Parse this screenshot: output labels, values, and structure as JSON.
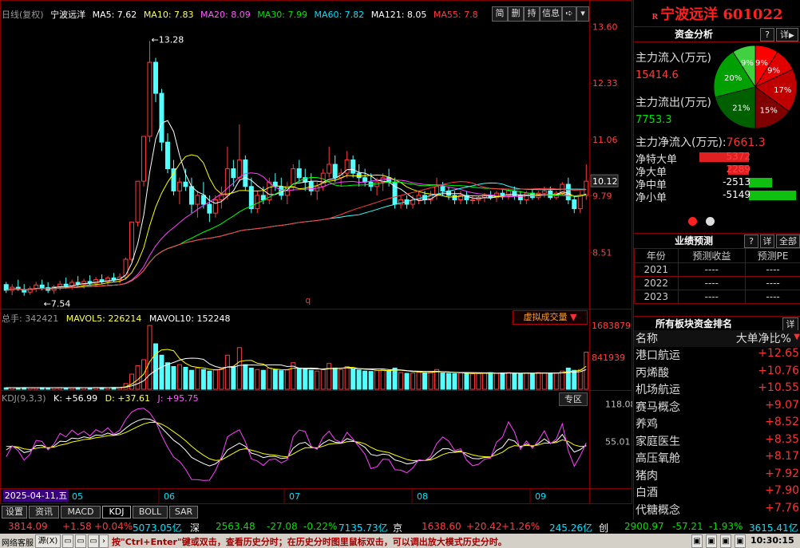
{
  "header": {
    "chart_name": "日线(复权)",
    "stock_name": "宁波远洋",
    "ma5": "MA5: 7.62",
    "ma10": "MA10: 7.83",
    "ma20": "MA20: 8.09",
    "ma30": "MA30: 7.99",
    "ma60": "MA60: 7.82",
    "ma121": "MA121: 8.05",
    "ma55": "MA55: 7.8",
    "tools": [
      "简",
      "删",
      "持",
      "信息"
    ]
  },
  "colors": {
    "ma5": "#ffffff",
    "ma10": "#ffff00",
    "ma20": "#ff40ff",
    "ma30": "#00ff00",
    "ma60": "#40ffff",
    "ma121": "#ffffff",
    "ma55": "#ff4040",
    "up": "#ff3c3c",
    "down": "#54ffff"
  },
  "price_axis": [
    "13.60",
    "12.33",
    "11.06",
    "10.12",
    "9.79",
    "8.51"
  ],
  "annotations": {
    "high": "13.28",
    "low": "7.54",
    "q_marker": "q"
  },
  "volume_header": {
    "total": "总手: 342421",
    "mavol5": "MAVOL5: 226214",
    "mavol10": "MAVOL10: 152248",
    "virtual_btn": "虚拟成交量"
  },
  "volume_axis": [
    "1683879",
    "841939"
  ],
  "kdj_header": {
    "name": "KDJ(9,3,3)",
    "k": "K: +56.99",
    "d": "D: +37.61",
    "j": "J: +95.75",
    "zq_btn": "专区"
  },
  "kdj_axis": [
    "118.08",
    "55.01"
  ],
  "date_axis": {
    "current": "2025-04-11,五",
    "months": [
      "05",
      "06",
      "07",
      "08",
      "09"
    ]
  },
  "tabs": [
    "设置",
    "资讯",
    "MACD",
    "KDJ",
    "BOLL",
    "SAR"
  ],
  "right_panel": {
    "title": "宁波远洋 601022",
    "flow_section": {
      "title": "资金分析",
      "btn_q": "?",
      "btn_detail": "详"
    },
    "inflow_label": "主力流入(万元)",
    "inflow_value": "15414.6",
    "outflow_label": "主力流出(万元)",
    "outflow_value": "7753.3",
    "net_label": "主力净流入(万元):",
    "net_value": "7661.3",
    "pie": [
      {
        "label": "9%",
        "value": 9,
        "color": "#ff0000"
      },
      {
        "label": "9%",
        "value": 9,
        "color": "#e00000"
      },
      {
        "label": "17%",
        "value": 17,
        "color": "#c00000"
      },
      {
        "label": "15%",
        "value": 15,
        "color": "#800000"
      },
      {
        "label": "21%",
        "value": 21,
        "color": "#006000"
      },
      {
        "label": "20%",
        "value": 20,
        "color": "#00a000"
      },
      {
        "label": "9%",
        "value": 9,
        "color": "#40d040"
      }
    ],
    "order_rows": [
      {
        "label": "净特大单",
        "value": "5372",
        "sign": "pos"
      },
      {
        "label": "净大单",
        "value": "2289",
        "sign": "pos"
      },
      {
        "label": "净中单",
        "value": "-2513",
        "sign": "neg"
      },
      {
        "label": "净小单",
        "value": "-5149",
        "sign": "neg"
      }
    ],
    "forecast": {
      "title": "业绩预测",
      "btn_q": "?",
      "btn_detail": "详",
      "btn_all": "全部",
      "headers": [
        "年份",
        "预测收益",
        "预测PE"
      ],
      "rows": [
        [
          "2021",
          "----",
          "----"
        ],
        [
          "2022",
          "----",
          "----"
        ],
        [
          "2023",
          "----",
          "----"
        ]
      ]
    },
    "sectors": {
      "title": "所有板块资金排名",
      "btn_detail": "详",
      "col_name": "名称",
      "col_val": "大单净比%",
      "rows": [
        {
          "name": "港口航运",
          "value": "+12.65"
        },
        {
          "name": "丙烯酸",
          "value": "+10.76"
        },
        {
          "name": "机场航运",
          "value": "+10.55"
        },
        {
          "name": "赛马概念",
          "value": "+9.07"
        },
        {
          "name": "养鸡",
          "value": "+8.52"
        },
        {
          "name": "家庭医生",
          "value": "+8.35"
        },
        {
          "name": "高压氧舱",
          "value": "+8.17"
        },
        {
          "name": "猪肉",
          "value": "+7.92"
        },
        {
          "name": "白酒",
          "value": "+7.90"
        },
        {
          "name": "代糖概念",
          "value": "+7.76"
        }
      ]
    }
  },
  "status_bar": {
    "idx1": "3814.09",
    "chg1": "+1.58",
    "pct1": "+0.04%",
    "amt1": "5073.05亿",
    "tag1": "深",
    "idx2": "2563.48",
    "chg2": "-27.08",
    "pct2": "-0.22%",
    "amt2": "7135.73亿",
    "tag2": "京",
    "idx3": "1638.60",
    "chg3": "+20.42",
    "pct3": "+1.26%",
    "amt3": "245.26亿",
    "tag3": "创",
    "idx4": "2900.97",
    "chg4": "-57.21",
    "pct4": "-1.93%",
    "amt4": "3615.41亿"
  },
  "bottom_bar": {
    "left": "网络客服",
    "btn": "源(X)",
    "hint": "按\"Ctrl+Enter\"键或双击，查看历史分时；在历史分时图里鼠标双击，可以调出放大模式历史分时。",
    "time": "10:30:15"
  },
  "chart_data": {
    "type": "candlestick",
    "title": "日线(复权)",
    "ylim": [
      7.3,
      13.7
    ],
    "ohlc": [
      [
        7.79,
        7.85,
        7.6,
        7.66
      ],
      [
        7.66,
        7.8,
        7.55,
        7.73
      ],
      [
        7.73,
        7.9,
        7.65,
        7.68
      ],
      [
        7.68,
        7.8,
        7.54,
        7.62
      ],
      [
        7.62,
        7.75,
        7.56,
        7.7
      ],
      [
        7.7,
        7.85,
        7.62,
        7.78
      ],
      [
        7.78,
        7.9,
        7.66,
        7.72
      ],
      [
        7.72,
        7.84,
        7.6,
        7.66
      ],
      [
        7.66,
        7.78,
        7.58,
        7.74
      ],
      [
        7.74,
        7.88,
        7.66,
        7.8
      ],
      [
        7.8,
        7.95,
        7.7,
        7.76
      ],
      [
        7.76,
        7.9,
        7.68,
        7.84
      ],
      [
        7.84,
        7.98,
        7.76,
        7.8
      ],
      [
        7.8,
        7.92,
        7.7,
        7.86
      ],
      [
        7.86,
        8.0,
        7.78,
        7.82
      ],
      [
        7.82,
        7.96,
        7.74,
        7.9
      ],
      [
        7.9,
        8.02,
        7.8,
        7.86
      ],
      [
        7.86,
        7.98,
        7.78,
        7.94
      ],
      [
        7.94,
        8.05,
        7.84,
        7.9
      ],
      [
        7.9,
        8.04,
        7.82,
        7.96
      ],
      [
        7.96,
        8.4,
        7.9,
        8.36
      ],
      [
        8.36,
        9.2,
        8.3,
        9.2
      ],
      [
        9.2,
        10.12,
        9.1,
        10.12
      ],
      [
        10.12,
        11.13,
        10.0,
        11.13
      ],
      [
        11.13,
        13.28,
        11.0,
        12.8
      ],
      [
        12.8,
        12.9,
        11.9,
        12.1
      ],
      [
        12.1,
        12.2,
        10.8,
        11.0
      ],
      [
        11.0,
        11.2,
        10.3,
        10.4
      ],
      [
        10.4,
        10.6,
        9.8,
        9.9
      ],
      [
        9.9,
        10.2,
        9.6,
        10.1
      ],
      [
        10.1,
        10.4,
        9.9,
        10.0
      ],
      [
        10.0,
        10.2,
        9.4,
        9.6
      ],
      [
        9.6,
        9.9,
        9.3,
        9.8
      ],
      [
        9.8,
        10.1,
        9.5,
        9.6
      ],
      [
        9.6,
        9.8,
        9.2,
        9.4
      ],
      [
        9.4,
        9.8,
        9.3,
        9.7
      ],
      [
        9.7,
        10.0,
        9.5,
        9.8
      ],
      [
        9.8,
        10.9,
        9.7,
        10.4
      ],
      [
        10.4,
        10.6,
        10.0,
        10.2
      ],
      [
        10.2,
        11.4,
        10.1,
        10.6
      ],
      [
        10.6,
        10.7,
        9.9,
        10.0
      ],
      [
        10.0,
        10.2,
        9.4,
        9.5
      ],
      [
        9.5,
        9.9,
        9.4,
        9.8
      ],
      [
        9.8,
        10.0,
        9.6,
        9.7
      ],
      [
        9.7,
        10.2,
        9.6,
        10.1
      ],
      [
        10.1,
        10.3,
        9.9,
        10.0
      ],
      [
        10.0,
        10.2,
        9.7,
        9.8
      ],
      [
        9.8,
        10.1,
        9.6,
        10.0
      ],
      [
        10.0,
        10.5,
        9.9,
        10.4
      ],
      [
        10.4,
        10.6,
        10.1,
        10.2
      ],
      [
        10.2,
        10.4,
        9.9,
        10.1
      ],
      [
        10.1,
        10.3,
        9.8,
        9.9
      ],
      [
        9.9,
        10.1,
        9.7,
        10.0
      ],
      [
        10.0,
        10.4,
        9.9,
        10.3
      ],
      [
        10.3,
        10.9,
        10.2,
        10.5
      ],
      [
        10.5,
        10.7,
        10.1,
        10.2
      ],
      [
        10.2,
        10.4,
        10.0,
        10.3
      ],
      [
        10.3,
        10.8,
        10.2,
        10.6
      ],
      [
        10.6,
        10.7,
        10.2,
        10.3
      ],
      [
        10.3,
        10.5,
        10.0,
        10.2
      ],
      [
        10.2,
        10.4,
        10.0,
        10.1
      ],
      [
        10.1,
        10.3,
        9.9,
        10.0
      ],
      [
        10.0,
        10.2,
        9.8,
        10.1
      ],
      [
        10.1,
        10.3,
        9.9,
        10.2
      ],
      [
        10.2,
        10.4,
        10.0,
        10.1
      ],
      [
        10.1,
        10.2,
        9.5,
        9.6
      ],
      [
        9.6,
        9.8,
        9.5,
        9.7
      ],
      [
        9.7,
        9.8,
        9.5,
        9.6
      ],
      [
        9.6,
        9.8,
        9.5,
        9.7
      ],
      [
        9.7,
        9.9,
        9.6,
        9.8
      ],
      [
        9.8,
        9.9,
        9.6,
        9.7
      ],
      [
        9.7,
        9.9,
        9.6,
        9.8
      ],
      [
        9.8,
        10.2,
        9.7,
        10.0
      ],
      [
        10.0,
        10.1,
        9.8,
        9.9
      ],
      [
        9.9,
        10.0,
        9.7,
        9.8
      ],
      [
        9.8,
        9.9,
        9.6,
        9.7
      ],
      [
        9.7,
        9.9,
        9.6,
        9.8
      ],
      [
        9.8,
        9.9,
        9.6,
        9.7
      ],
      [
        9.7,
        9.8,
        9.6,
        9.7
      ],
      [
        9.7,
        9.8,
        9.6,
        9.75
      ],
      [
        9.75,
        9.85,
        9.65,
        9.8
      ],
      [
        9.8,
        9.9,
        9.7,
        9.75
      ],
      [
        9.75,
        9.9,
        9.65,
        9.85
      ],
      [
        9.85,
        9.95,
        9.7,
        9.8
      ],
      [
        9.8,
        9.95,
        9.7,
        9.9
      ],
      [
        9.9,
        10.0,
        9.7,
        9.8
      ],
      [
        9.8,
        9.9,
        9.6,
        9.7
      ],
      [
        9.7,
        9.9,
        9.6,
        9.85
      ],
      [
        9.85,
        9.95,
        9.7,
        9.75
      ],
      [
        9.75,
        9.9,
        9.7,
        9.85
      ],
      [
        9.85,
        10.0,
        9.75,
        9.9
      ],
      [
        9.9,
        10.0,
        9.7,
        9.75
      ],
      [
        9.75,
        9.9,
        9.7,
        9.85
      ],
      [
        9.85,
        10.1,
        9.8,
        10.05
      ],
      [
        10.05,
        10.2,
        9.6,
        9.7
      ],
      [
        9.7,
        9.8,
        9.4,
        9.5
      ],
      [
        9.5,
        9.9,
        9.4,
        9.8
      ],
      [
        9.8,
        10.5,
        9.7,
        10.12
      ]
    ],
    "volume": [
      40,
      42,
      38,
      45,
      41,
      39,
      44,
      40,
      43,
      46,
      42,
      40,
      45,
      43,
      41,
      47,
      44,
      42,
      46,
      45,
      150,
      400,
      620,
      780,
      1683,
      1200,
      900,
      700,
      600,
      650,
      580,
      500,
      560,
      520,
      480,
      510,
      540,
      900,
      600,
      1100,
      650,
      560,
      520,
      500,
      560,
      520,
      490,
      510,
      700,
      560,
      530,
      500,
      480,
      520,
      680,
      560,
      520,
      600,
      540,
      510,
      480,
      470,
      500,
      520,
      490,
      560,
      440,
      420,
      430,
      450,
      440,
      460,
      520,
      430,
      420,
      410,
      430,
      420,
      410,
      420,
      430,
      440,
      420,
      430,
      440,
      420,
      410,
      430,
      420,
      440,
      430,
      420,
      430,
      480,
      560,
      500,
      520,
      980
    ],
    "kdj": {
      "k": [
        56.99
      ],
      "d": [
        37.61
      ],
      "j": [
        95.75
      ]
    }
  }
}
